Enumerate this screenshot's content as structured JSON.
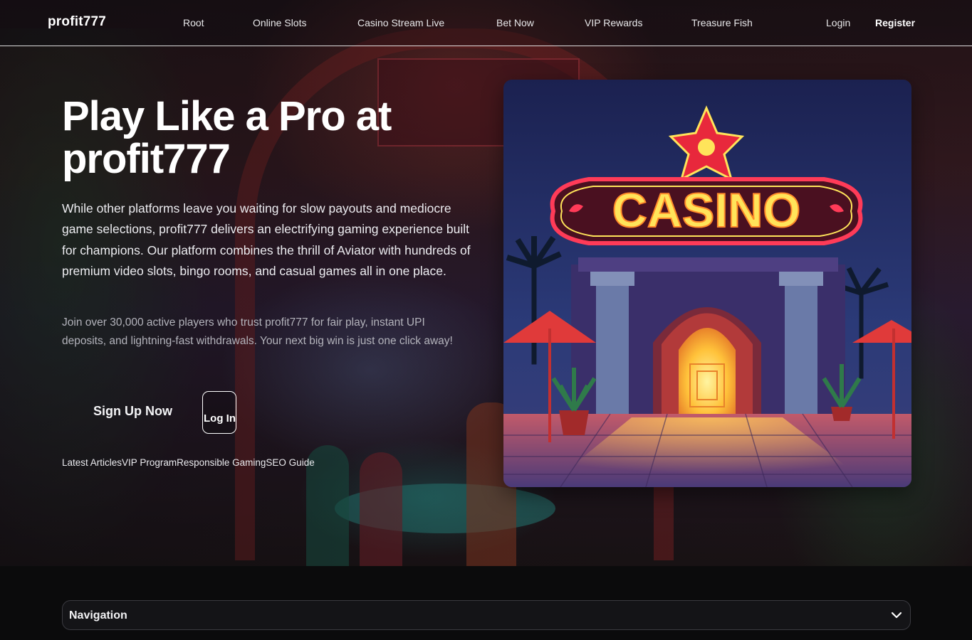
{
  "header": {
    "logo": "profit777",
    "nav": [
      {
        "label": "Root"
      },
      {
        "label": "Online Slots"
      },
      {
        "label": "Casino Stream Live"
      },
      {
        "label": "Bet Now"
      },
      {
        "label": "VIP Rewards"
      },
      {
        "label": "Treasure Fish"
      }
    ],
    "login_label": "Login",
    "register_label": "Register"
  },
  "hero": {
    "title": "Play Like a Pro at profit777",
    "description": "While other platforms leave you waiting for slow payouts and mediocre game selections, profit777 delivers an electrifying gaming experience built for champions. Our platform combines the thrill of Aviator with hundreds of premium video slots, bingo rooms, and casual games all in one place.",
    "subtext": "Join over 30,000 active players who trust profit777 for fair play, instant UPI deposits, and lightning-fast withdrawals. Your next big win is just one click away!",
    "signup_label": "Sign Up Now",
    "login_label": "Log In",
    "links": [
      {
        "label": "Latest Articles"
      },
      {
        "label": "VIP Program"
      },
      {
        "label": "Responsible Gaming"
      },
      {
        "label": "SEO Guide"
      }
    ]
  },
  "casino_image": {
    "sign_text": "CASINO"
  },
  "navigation_panel": {
    "label": "Navigation",
    "icon": "chevron-down-icon"
  },
  "colors": {
    "background": "#0b0b0c",
    "neon_red": "#e8283c",
    "neon_yellow": "#ffe45a",
    "text_muted": "#b3b3bb"
  }
}
